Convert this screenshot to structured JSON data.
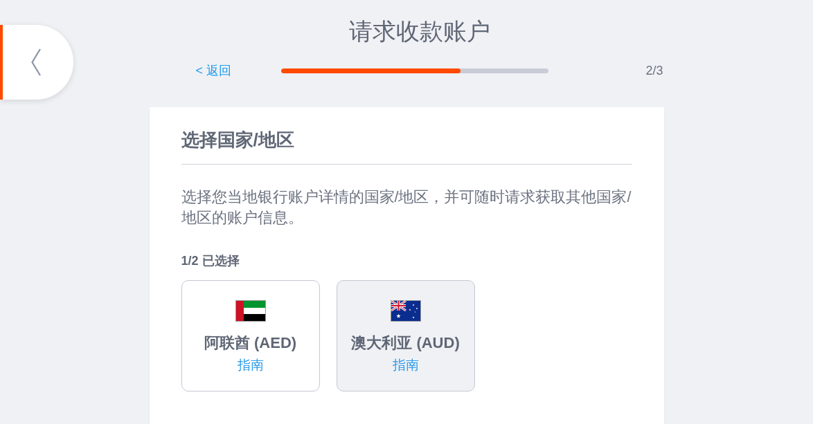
{
  "page": {
    "title": "请求收款账户"
  },
  "progress": {
    "back_link": "< 返回",
    "level": 0.67,
    "step": "2/3"
  },
  "card": {
    "heading": "选择国家/地区",
    "description": "选择您当地银行账户详情的国家/地区，并可随时请求获取其他国家/地区的账户信息。",
    "selection_count": "1/2 已选择",
    "countries": [
      {
        "kind": "uae",
        "name": "阿联酋 (AED)",
        "guide_link": "指南",
        "selected": false
      },
      {
        "kind": "australia",
        "name": "澳大利亚 (AUD)",
        "guide_link": "指南",
        "selected": true
      }
    ]
  }
}
